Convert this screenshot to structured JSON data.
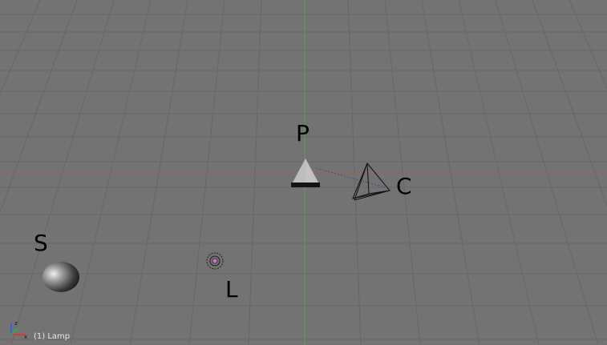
{
  "viewport": {
    "status_text": "(1) Lamp"
  },
  "objects": {
    "pyramid": {
      "label": "P"
    },
    "camera": {
      "label": "C"
    },
    "sphere": {
      "label": "S"
    },
    "lamp": {
      "label": "L"
    }
  },
  "axis_gizmo": {
    "x_label": "x",
    "z_label": "z"
  },
  "colors": {
    "background": "#737373",
    "grid_line": "#666666",
    "x_axis": "#b05050",
    "y_axis": "#4fa04f",
    "lamp_accent": "#c060c0"
  }
}
